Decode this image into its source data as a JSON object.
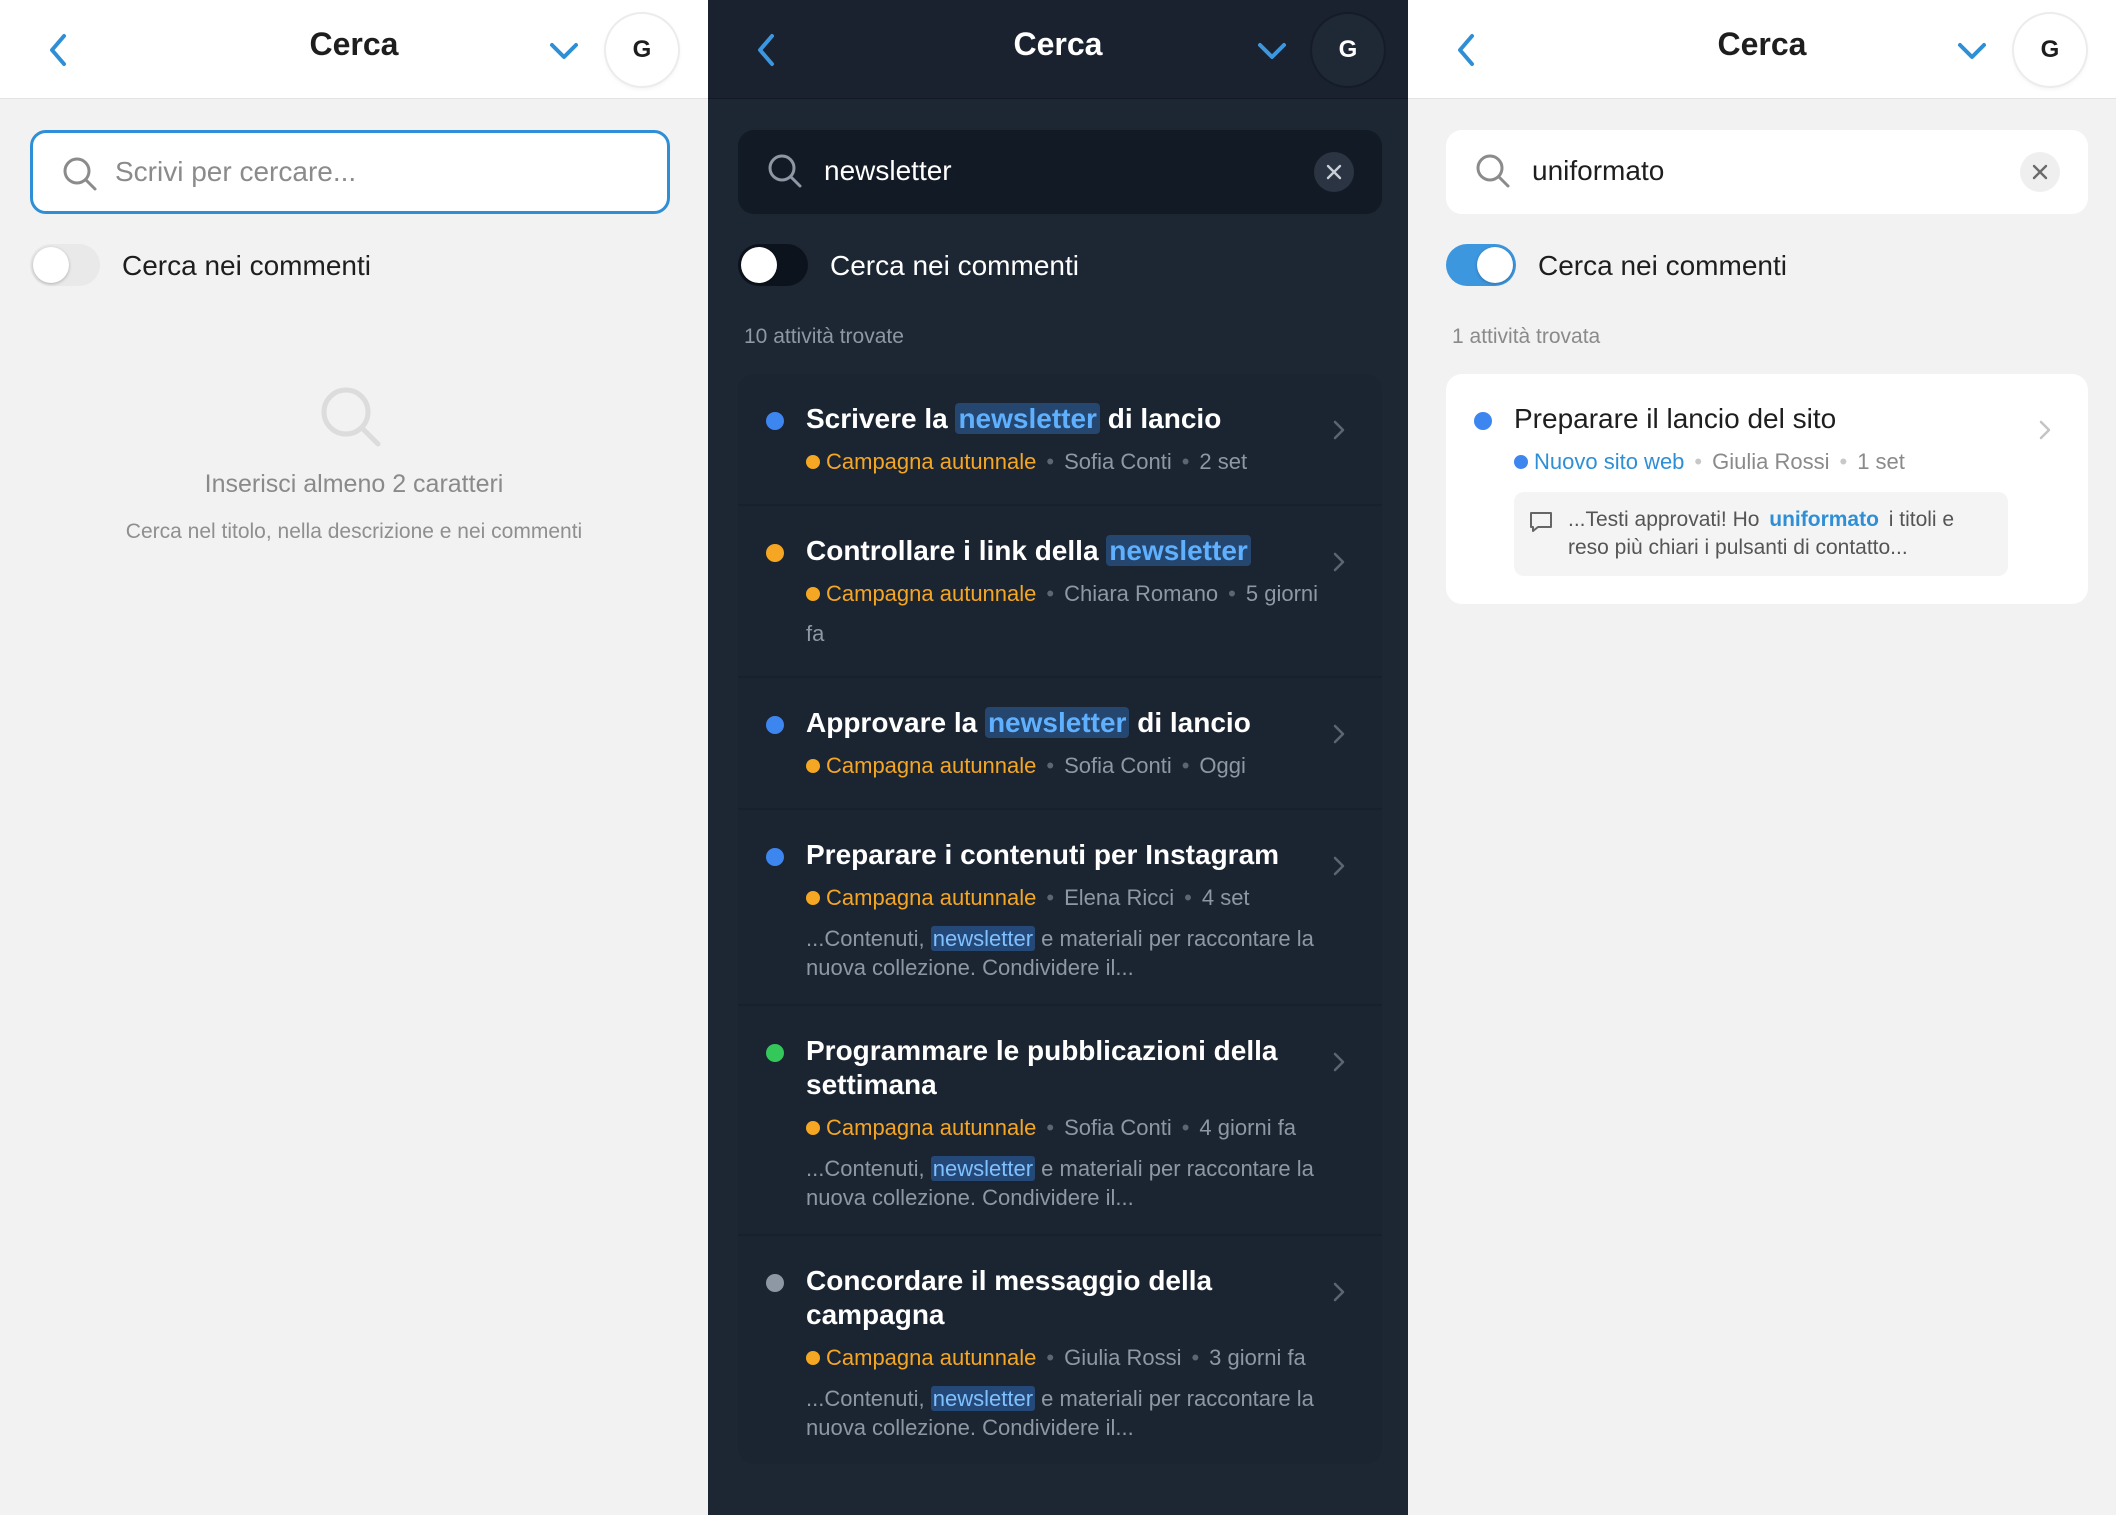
{
  "panels": {
    "empty": {
      "header": {
        "title": "Cerca",
        "avatar": "G"
      },
      "search": {
        "placeholder": "Scrivi per cercare..."
      },
      "toggle": {
        "label": "Cerca nei commenti",
        "on": false
      },
      "empty_state": {
        "title": "Inserisci almeno 2 caratteri",
        "subtitle": "Cerca nel titolo, nella descrizione e nei commenti"
      }
    },
    "newsletter": {
      "header": {
        "title": "Cerca",
        "avatar": "G"
      },
      "search": {
        "value": "newsletter"
      },
      "toggle": {
        "label": "Cerca nei commenti",
        "on": false
      },
      "count": "10 attività trovate",
      "results": [
        {
          "dot": "#3d86f0",
          "pre": "Scrivere la ",
          "hl": "newsletter",
          "post": " di lancio",
          "project": "Campagna autunnale",
          "person": "Sofia Conti",
          "date": "2 set",
          "snip_pre": "",
          "snip_hl": "",
          "snip_post": ""
        },
        {
          "dot": "#f5a623",
          "pre": "Controllare i link della ",
          "hl": "newsletter",
          "post": "",
          "project": "Campagna autunnale",
          "person": "Chiara Romano",
          "date": "5 giorni fa",
          "snip_pre": "",
          "snip_hl": "",
          "snip_post": ""
        },
        {
          "dot": "#3d86f0",
          "pre": "Approvare la ",
          "hl": "newsletter",
          "post": " di lancio",
          "project": "Campagna autunnale",
          "person": "Sofia Conti",
          "date": "Oggi",
          "snip_pre": "",
          "snip_hl": "",
          "snip_post": ""
        },
        {
          "dot": "#3d86f0",
          "pre": "Preparare i contenuti per Instagram",
          "hl": "",
          "post": "",
          "project": "Campagna autunnale",
          "person": "Elena Ricci",
          "date": "4 set",
          "snip_pre": "...Contenuti, ",
          "snip_hl": "newsletter",
          "snip_post": " e materiali per raccontare la nuova collezione. Condividere il..."
        },
        {
          "dot": "#34c759",
          "pre": "Programmare le pubblicazioni della settimana",
          "hl": "",
          "post": "",
          "project": "Campagna autunnale",
          "person": "Sofia Conti",
          "date": "4 giorni fa",
          "snip_pre": "...Contenuti, ",
          "snip_hl": "newsletter",
          "snip_post": " e materiali per raccontare la nuova collezione. Condividere il..."
        },
        {
          "dot": "#8e97a4",
          "pre": "Concordare il messaggio della campagna",
          "hl": "",
          "post": "",
          "project": "Campagna autunnale",
          "person": "Giulia Rossi",
          "date": "3 giorni fa",
          "snip_pre": "...Contenuti, ",
          "snip_hl": "newsletter",
          "snip_post": " e materiali per raccontare la nuova collezione. Condividere il..."
        }
      ]
    },
    "uniformato": {
      "header": {
        "title": "Cerca",
        "avatar": "G"
      },
      "search": {
        "value": "uniformato"
      },
      "toggle": {
        "label": "Cerca nei commenti",
        "on": true
      },
      "count": "1 attività trovata",
      "result": {
        "title": "Preparare il lancio del sito",
        "project": "Nuovo sito web",
        "person": "Giulia Rossi",
        "date": "1 set",
        "comment_pre": "...Testi approvati! Ho ",
        "comment_hl": "uniformato",
        "comment_post": " i titoli e reso più chiari i pulsanti di contatto..."
      }
    }
  },
  "colors": {
    "accent": "#2f8fd6",
    "dark_bg": "#1d2633",
    "light_bg": "#f2f2f2",
    "project_orange": "#f5a623"
  },
  "icons": [
    "chevron-left-icon",
    "chevron-down-icon",
    "search-icon",
    "close-icon",
    "chevron-right-icon",
    "comment-icon"
  ]
}
